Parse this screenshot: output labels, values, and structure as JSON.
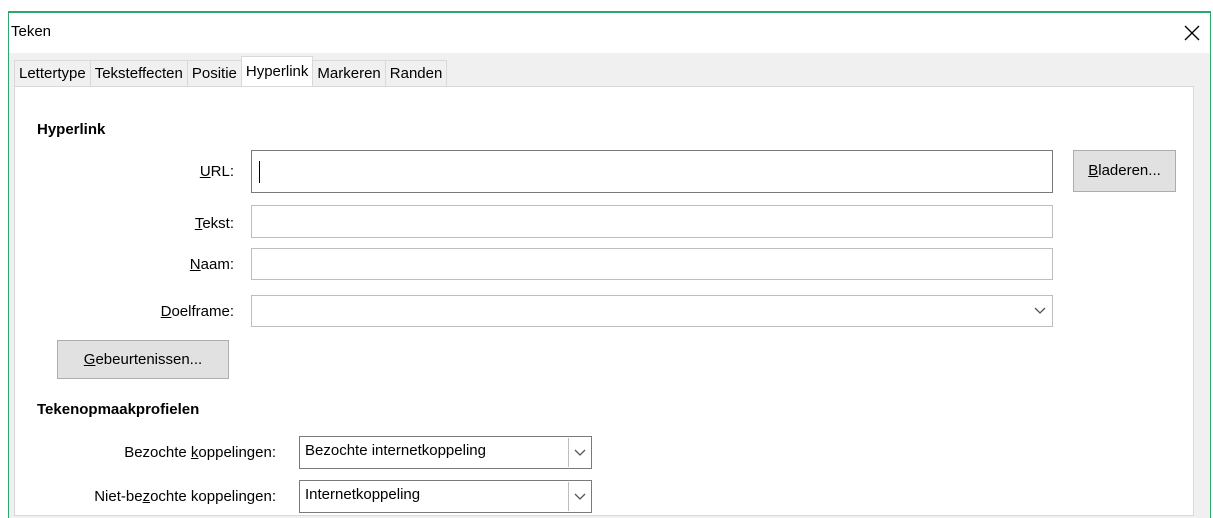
{
  "window": {
    "title": "Teken",
    "close_icon": "close-icon"
  },
  "tabs": [
    {
      "label": "Lettertype"
    },
    {
      "label": "Teksteffecten"
    },
    {
      "label": "Positie"
    },
    {
      "label": "Hyperlink",
      "active": true
    },
    {
      "label": "Markeren"
    },
    {
      "label": "Randen"
    }
  ],
  "hyperlink": {
    "section_title": "Hyperlink",
    "url_label_mnemonic": "U",
    "url_label_rest": "RL:",
    "url_value": "",
    "browse_mnemonic": "B",
    "browse_rest": "laderen...",
    "text_label_mnemonic": "T",
    "text_label_rest": "ekst:",
    "text_value": "",
    "name_label_mnemonic": "N",
    "name_label_rest": "aam:",
    "name_value": "",
    "target_label_mnemonic": "D",
    "target_label_rest": "oelframe:",
    "target_value": "",
    "events_mnemonic": "G",
    "events_rest": "ebeurtenissen..."
  },
  "char_styles": {
    "section_title": "Tekenopmaakprofielen",
    "visited_label_pre": "Bezochte ",
    "visited_label_mnemonic": "k",
    "visited_label_post": "oppelingen:",
    "visited_value": "Bezochte internetkoppeling",
    "unvisited_label_pre": "Niet-be",
    "unvisited_label_mnemonic": "z",
    "unvisited_label_post": "ochte koppelingen:",
    "unvisited_value": "Internetkoppeling"
  }
}
